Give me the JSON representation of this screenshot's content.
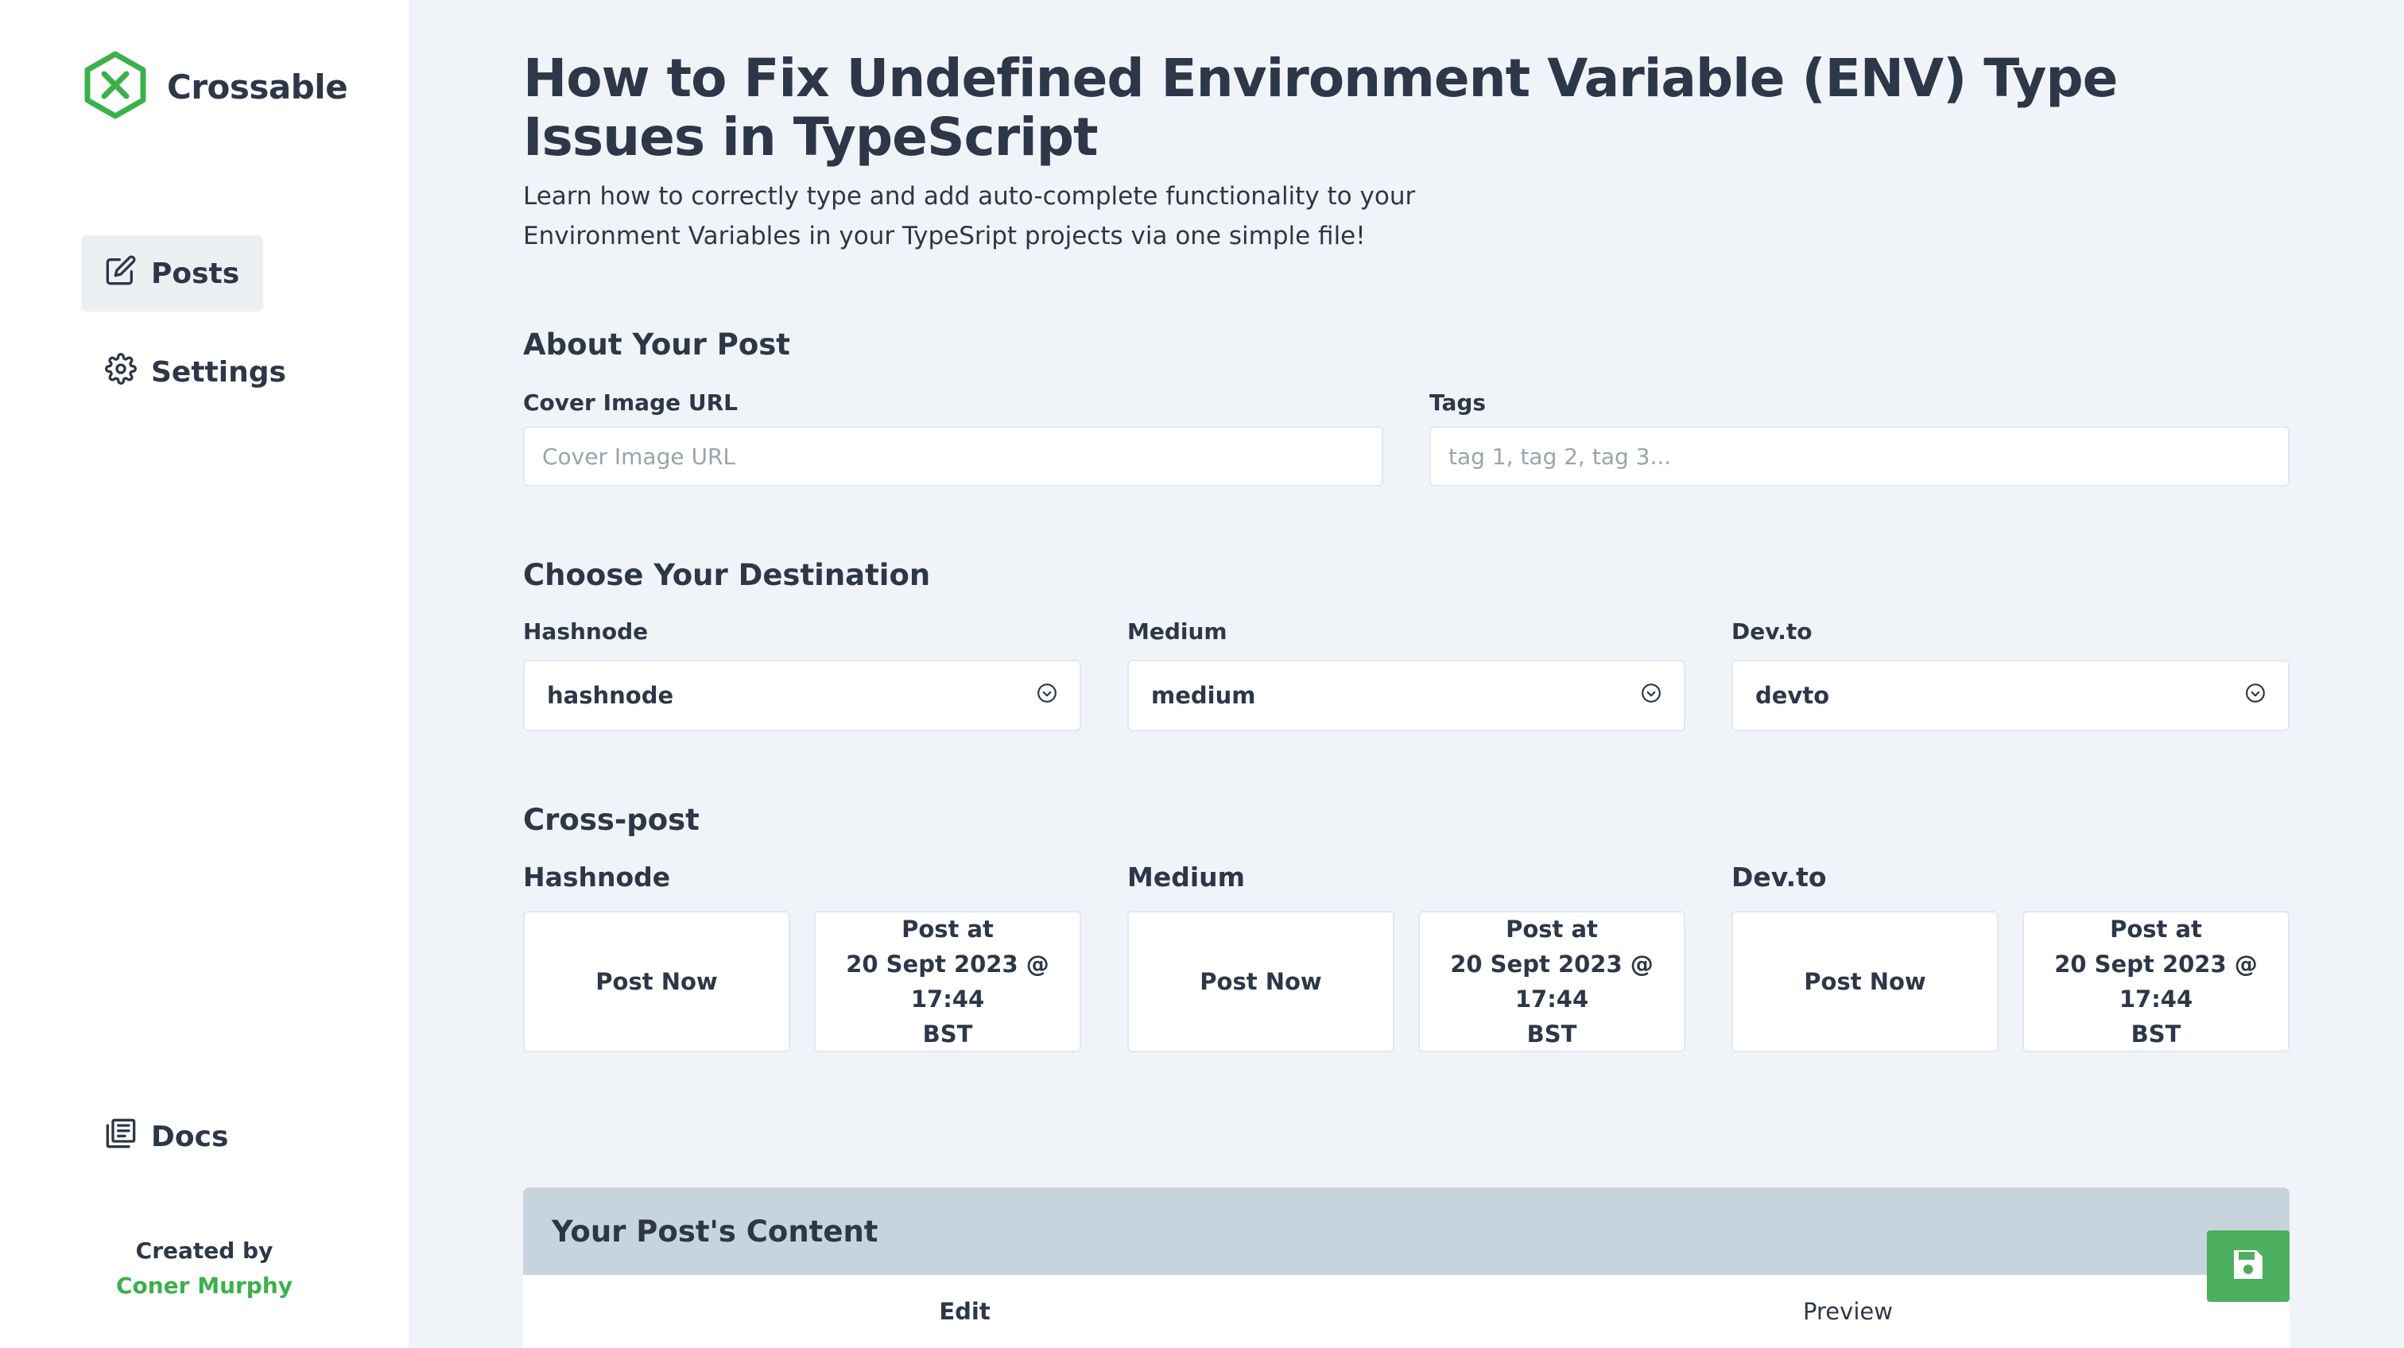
{
  "brand": {
    "name": "Crossable",
    "accent": "#3cb04b"
  },
  "nav": {
    "posts": "Posts",
    "settings": "Settings",
    "docs": "Docs"
  },
  "credit": {
    "label": "Created by",
    "author": "Coner Murphy"
  },
  "post": {
    "title": "How to Fix Undefined Environment Variable (ENV) Type Issues in TypeScript",
    "subtitle": "Learn how to correctly type and add auto-complete functionality to your Environment Variables in your TypeSript projects via one simple file!"
  },
  "about": {
    "heading": "About Your Post",
    "cover_label": "Cover Image URL",
    "cover_placeholder": "Cover Image URL",
    "cover_value": "",
    "tags_label": "Tags",
    "tags_placeholder": "tag 1, tag 2, tag 3...",
    "tags_value": ""
  },
  "destination": {
    "heading": "Choose Your Destination",
    "items": [
      {
        "label": "Hashnode",
        "value": "hashnode"
      },
      {
        "label": "Medium",
        "value": "medium"
      },
      {
        "label": "Dev.to",
        "value": "devto"
      }
    ]
  },
  "crosspost": {
    "heading": "Cross-post",
    "platforms": [
      {
        "label": "Hashnode",
        "post_now": "Post Now",
        "post_at_1": "Post at",
        "post_at_2": "20 Sept 2023 @ 17:44",
        "post_at_3": "BST"
      },
      {
        "label": "Medium",
        "post_now": "Post Now",
        "post_at_1": "Post at",
        "post_at_2": "20 Sept 2023 @ 17:44",
        "post_at_3": "BST"
      },
      {
        "label": "Dev.to",
        "post_now": "Post Now",
        "post_at_1": "Post at",
        "post_at_2": "20 Sept 2023 @ 17:44",
        "post_at_3": "BST"
      }
    ]
  },
  "content": {
    "heading": "Your Post's Content",
    "tabs": [
      "Edit",
      "Preview"
    ],
    "active_tab": "Edit"
  },
  "icons": {
    "logo": "crossable-logo-icon",
    "posts": "edit-icon",
    "settings": "gear-icon",
    "docs": "docs-icon",
    "select": "chevron-circle-down-icon",
    "save": "floppy-disk-icon"
  },
  "colors": {
    "sidebar_bg": "#ffffff",
    "page_bg": "#f0f4f8",
    "content_header_bg": "#c8d4dd",
    "save_button": "#4caf5f"
  }
}
